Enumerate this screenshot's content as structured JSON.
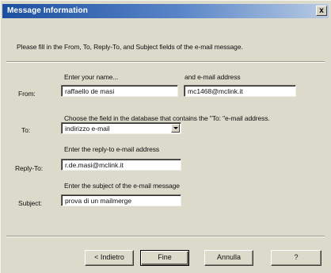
{
  "window": {
    "title": "Message Information",
    "close_glyph": "x"
  },
  "instructions": "Please fill in the From, To, Reply-To, and Subject fields of the e-mail message.",
  "from": {
    "label": "From:",
    "name_hint": "Enter your name...",
    "name_value": "raffaello de masi",
    "address_hint": "and e-mail address",
    "address_value": "mc1468@mclink.it"
  },
  "to": {
    "label": "To:",
    "hint": "Choose the field in the database that contains the \"To: \"e-mail address.",
    "selected": "indirizzo e-mail"
  },
  "reply_to": {
    "label": "Reply-To:",
    "hint": "Enter the reply-to e-mail address",
    "value": "r.de.masi@mclink.it"
  },
  "subject": {
    "label": "Subject:",
    "hint": "Enter the subject of the e-mail message",
    "value": "prova di un mailmerge"
  },
  "buttons": {
    "back": "< Indietro",
    "finish": "Fine",
    "cancel": "Annulla",
    "help": "?"
  }
}
